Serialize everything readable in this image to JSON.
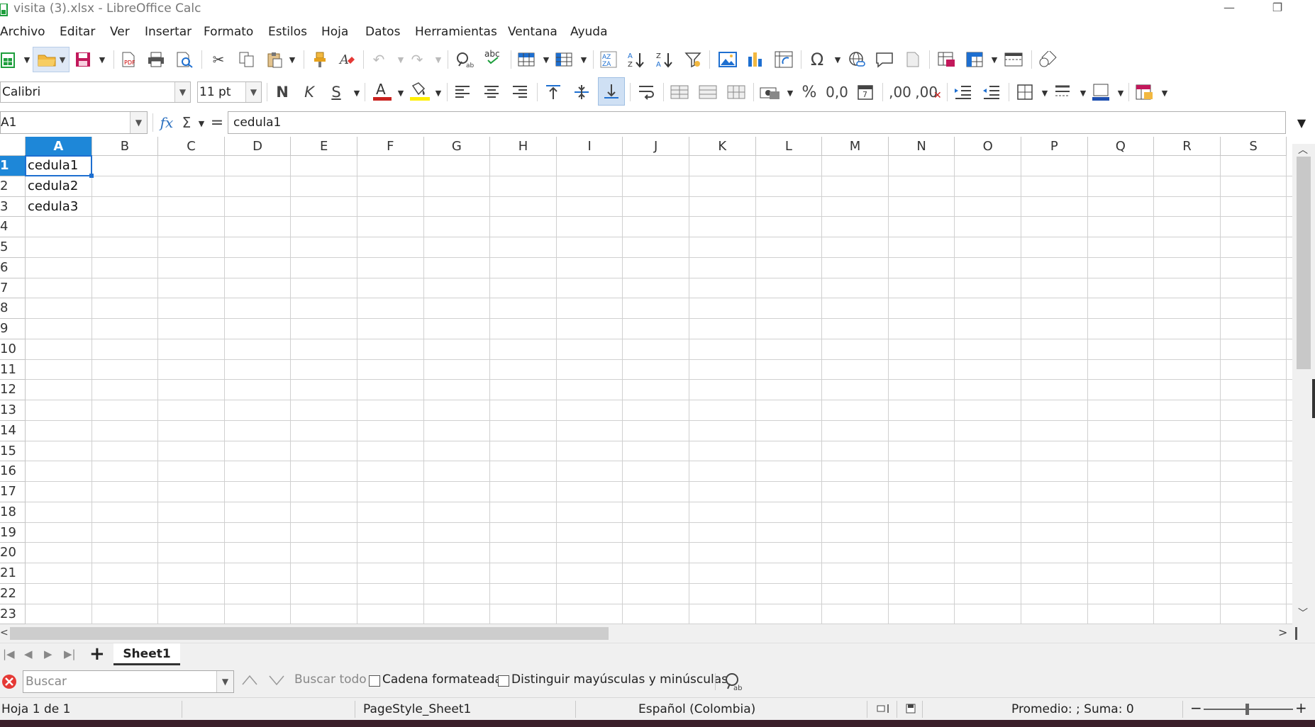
{
  "window": {
    "title": "visita (3).xlsx - LibreOffice Calc",
    "minimize": "—",
    "restore": "❐"
  },
  "menu": [
    "Archivo",
    "Editar",
    "Ver",
    "Insertar",
    "Formato",
    "Estilos",
    "Hoja",
    "Datos",
    "Herramientas",
    "Ventana",
    "Ayuda"
  ],
  "toolbar": {
    "font_name": "Calibri",
    "font_size": "11 pt",
    "bold": "N",
    "italic": "K",
    "underline": "S",
    "percent": "%",
    "number_format": "0,0",
    "add_decimal": ",00",
    "del_decimal": ",00"
  },
  "formula_bar": {
    "name_box": "A1",
    "fx": "fx",
    "sum": "Σ",
    "equals": "=",
    "content": "cedula1"
  },
  "columns": [
    "A",
    "B",
    "C",
    "D",
    "E",
    "F",
    "G",
    "H",
    "I",
    "J",
    "K",
    "L",
    "M",
    "N",
    "O",
    "P",
    "Q",
    "R",
    "S"
  ],
  "rows": [
    "1",
    "2",
    "3",
    "4",
    "5",
    "6",
    "7",
    "8",
    "9",
    "10",
    "11",
    "12",
    "13",
    "14",
    "15",
    "16",
    "17",
    "18",
    "19",
    "20",
    "21",
    "22",
    "23"
  ],
  "cells": {
    "A1": "cedula1",
    "A2": "cedula2",
    "A3": "cedula3"
  },
  "selected_cell": "A1",
  "sheet_tabs": {
    "add": "+",
    "active": "Sheet1"
  },
  "find_bar": {
    "placeholder": "Buscar",
    "find_all": "Buscar todo",
    "formatted": "Cadena formateada",
    "match_case": "Distinguir mayúsculas y minúsculas"
  },
  "status": {
    "sheet": "Hoja 1 de 1",
    "page_style": "PageStyle_Sheet1",
    "language": "Español (Colombia)",
    "summary": "Promedio: ; Suma: 0",
    "zoom_minus": "−",
    "zoom_plus": "+"
  },
  "colors": {
    "accent": "#1e87d8",
    "selection_border": "#1e6fd0",
    "bar_bg": "#f0f0f0"
  }
}
